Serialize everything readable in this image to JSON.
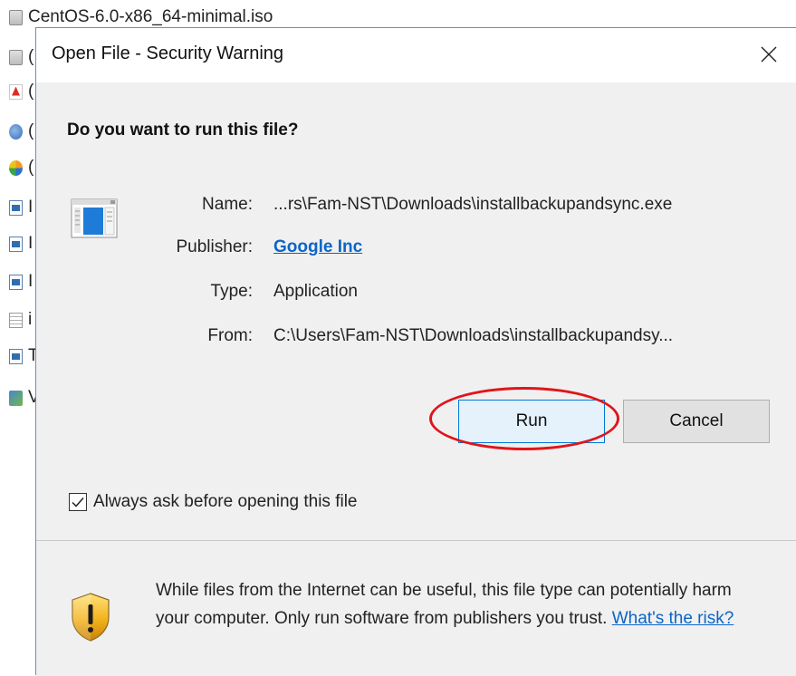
{
  "background_files": {
    "first_file_name": "CentOS-6.0-x86_64-minimal.iso",
    "partial_letters": [
      "(",
      "(",
      "(",
      "(",
      "(",
      "I",
      "I",
      "I",
      "i",
      "T",
      "V"
    ]
  },
  "dialog": {
    "title": "Open File - Security Warning",
    "question": "Do you want to run this file?",
    "name_label": "Name:",
    "name_value": "...rs\\Fam-NST\\Downloads\\installbackupandsync.exe",
    "publisher_label": "Publisher:",
    "publisher_value": "Google Inc",
    "type_label": "Type:",
    "type_value": "Application",
    "from_label": "From:",
    "from_value": "C:\\Users\\Fam-NST\\Downloads\\installbackupandsy...",
    "run_label": "Run",
    "cancel_label": "Cancel",
    "always_ask_label": "Always ask before opening this file",
    "always_ask_checked": true,
    "warning_text": "While files from the Internet can be useful, this file type can potentially harm your computer. Only run software from publishers you trust.",
    "risk_link": "What's the risk?"
  },
  "colors": {
    "link": "#0b65c7",
    "highlight_ring": "#e0151b",
    "dialog_bg": "#f0f0f0",
    "run_button_bg": "#e5f1fb",
    "run_button_border": "#0078d7"
  },
  "icons": {
    "close": "close-icon",
    "file": "application-file-icon",
    "shield": "warning-shield-icon",
    "checkmark": "checkmark-icon"
  }
}
